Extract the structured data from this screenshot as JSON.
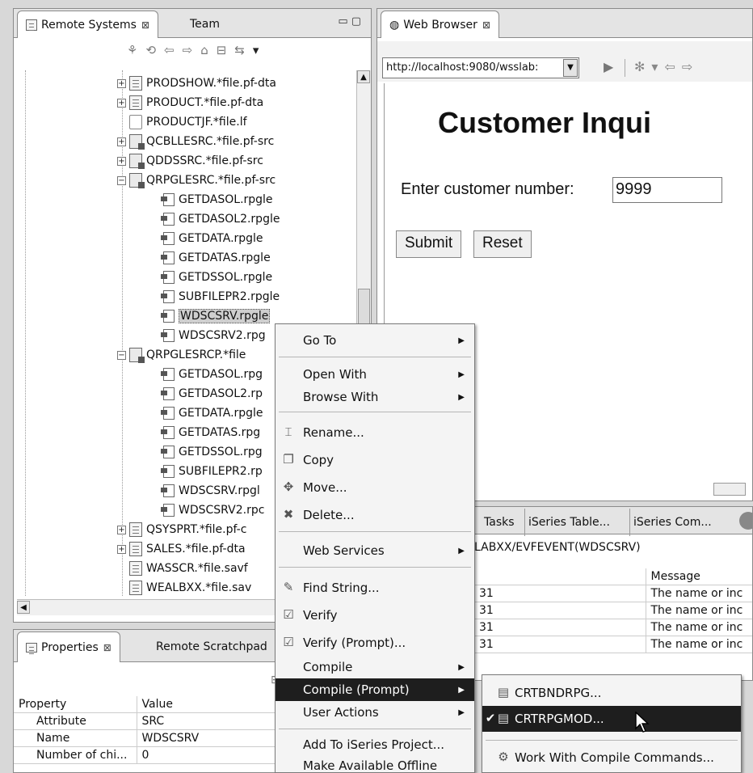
{
  "remote_systems": {
    "tabs": [
      {
        "label": "Remote Systems"
      },
      {
        "label": "Team"
      }
    ],
    "tree": [
      {
        "label": "PRODSHOW.*file.pf-dta"
      },
      {
        "label": "PRODUCT.*file.pf-dta"
      },
      {
        "label": "PRODUCTJF.*file.lf"
      },
      {
        "label": "QCBLLESRC.*file.pf-src"
      },
      {
        "label": "QDDSSRC.*file.pf-src"
      },
      {
        "label": "QRPGLESRC.*file.pf-src"
      },
      {
        "label": "GETDASOL.rpgle"
      },
      {
        "label": "GETDASOL2.rpgle"
      },
      {
        "label": "GETDATA.rpgle"
      },
      {
        "label": "GETDATAS.rpgle"
      },
      {
        "label": "GETDSSOL.rpgle"
      },
      {
        "label": "SUBFILEPR2.rpgle"
      },
      {
        "label": "WDSCSRV.rpgle"
      },
      {
        "label": "WDSCSRV2.rpg"
      },
      {
        "label": "QRPGLESRCP.*file"
      },
      {
        "label": "GETDASOL.rpg"
      },
      {
        "label": "GETDASOL2.rp"
      },
      {
        "label": "GETDATA.rpgle"
      },
      {
        "label": "GETDATAS.rpg"
      },
      {
        "label": "GETDSSOL.rpg"
      },
      {
        "label": "SUBFILEPR2.rp"
      },
      {
        "label": "WDSCSRV.rpgl"
      },
      {
        "label": "WDSCSRV2.rpc"
      },
      {
        "label": "QSYSPRT.*file.pf-c"
      },
      {
        "label": "SALES.*file.pf-dta"
      },
      {
        "label": "WASSCR.*file.savf"
      },
      {
        "label": "WEALBXX.*file.sav"
      }
    ]
  },
  "properties": {
    "tabs": [
      {
        "label": "Properties"
      },
      {
        "label": "Remote Scratchpad"
      }
    ],
    "headers": [
      "Property",
      "Value"
    ],
    "rows": [
      [
        "Attribute",
        "SRC"
      ],
      [
        "Name",
        "WDSCSRV"
      ],
      [
        "Number of chi...",
        "0"
      ]
    ]
  },
  "browser": {
    "tab_label": "Web Browser",
    "url": "http://localhost:9080/wsslab:",
    "heading": "Customer Inqui",
    "field_label": "Enter customer number:",
    "field_value": "9999",
    "submit_label": "Submit",
    "reset_label": "Reset"
  },
  "bottom": {
    "tabs": [
      {
        "label": "Tasks"
      },
      {
        "label": "iSeries Table..."
      },
      {
        "label": "iSeries Com..."
      }
    ],
    "path": "LABXX/EVFEVENT(WDSCSRV)",
    "message_header": "Message",
    "rows": [
      {
        "line": "31",
        "message": "The name or inc"
      },
      {
        "line": "31",
        "message": "The name or inc"
      },
      {
        "line": "31",
        "message": "The name or inc"
      },
      {
        "line": "31",
        "message": "The name or inc"
      }
    ]
  },
  "context_menu": {
    "items": [
      {
        "label": "Go To"
      },
      {
        "label": "Open With"
      },
      {
        "label": "Browse With"
      },
      {
        "label": "Rename..."
      },
      {
        "label": "Copy"
      },
      {
        "label": "Move..."
      },
      {
        "label": "Delete..."
      },
      {
        "label": "Web Services"
      },
      {
        "label": "Find String..."
      },
      {
        "label": "Verify"
      },
      {
        "label": "Verify (Prompt)..."
      },
      {
        "label": "Compile"
      },
      {
        "label": "Compile (Prompt)"
      },
      {
        "label": "User Actions"
      },
      {
        "label": "Add To iSeries Project..."
      },
      {
        "label": "Make Available Offline"
      }
    ]
  },
  "submenu": {
    "items": [
      {
        "label": "CRTBNDRPG..."
      },
      {
        "label": "CRTRPGMOD..."
      },
      {
        "label": "Work With Compile Commands..."
      }
    ]
  }
}
